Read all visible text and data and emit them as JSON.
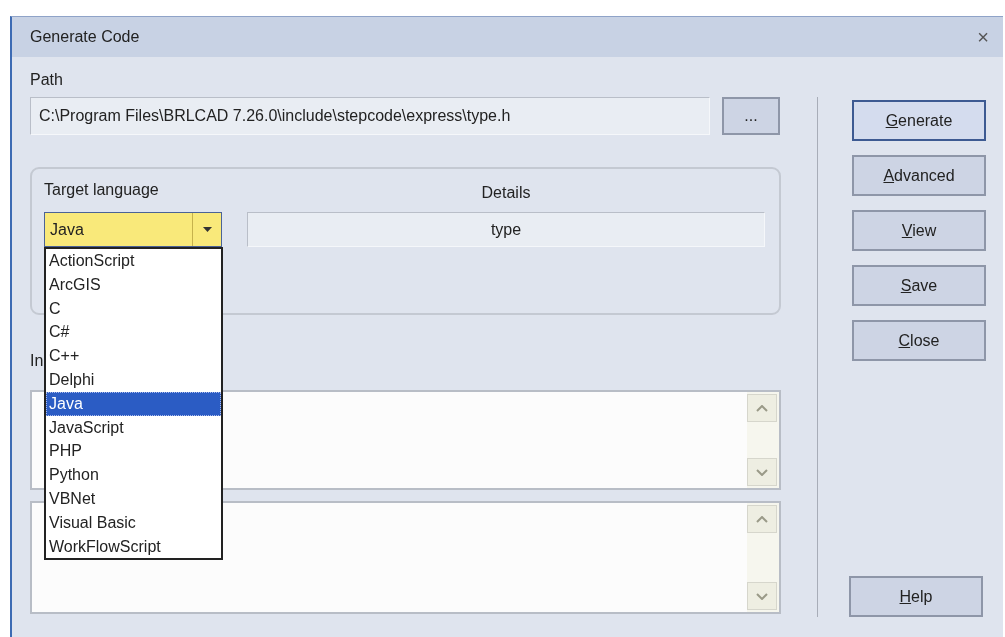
{
  "window": {
    "title": "Generate Code",
    "close": "×"
  },
  "path": {
    "label": "Path",
    "value": "C:\\Program Files\\BRLCAD 7.26.0\\include\\stepcode\\express\\type.h",
    "browse": "..."
  },
  "target": {
    "label": "Target language",
    "value": "Java",
    "focused": true,
    "expanded": true,
    "languages": [
      {
        "label": "ActionScript",
        "selected": false
      },
      {
        "label": "ArcGIS",
        "selected": false
      },
      {
        "label": "C",
        "selected": false
      },
      {
        "label": "C#",
        "selected": false
      },
      {
        "label": "C++",
        "selected": false
      },
      {
        "label": "Delphi",
        "selected": false
      },
      {
        "label": "Java",
        "selected": true
      },
      {
        "label": "JavaScript",
        "selected": false
      },
      {
        "label": "PHP",
        "selected": false
      },
      {
        "label": "Python",
        "selected": false
      },
      {
        "label": "VBNet",
        "selected": false
      },
      {
        "label": "Visual Basic",
        "selected": false
      },
      {
        "label": "WorkFlowScript",
        "selected": false
      }
    ]
  },
  "details": {
    "label": "Details",
    "value": "type"
  },
  "section_label": "In",
  "buttons": [
    {
      "label": "Generate",
      "default": true
    },
    {
      "label": "Advanced",
      "default": false
    },
    {
      "label": "View",
      "default": false
    },
    {
      "label": "Save",
      "default": false
    },
    {
      "label": "Close",
      "default": false
    }
  ],
  "help": {
    "label": "Help"
  }
}
